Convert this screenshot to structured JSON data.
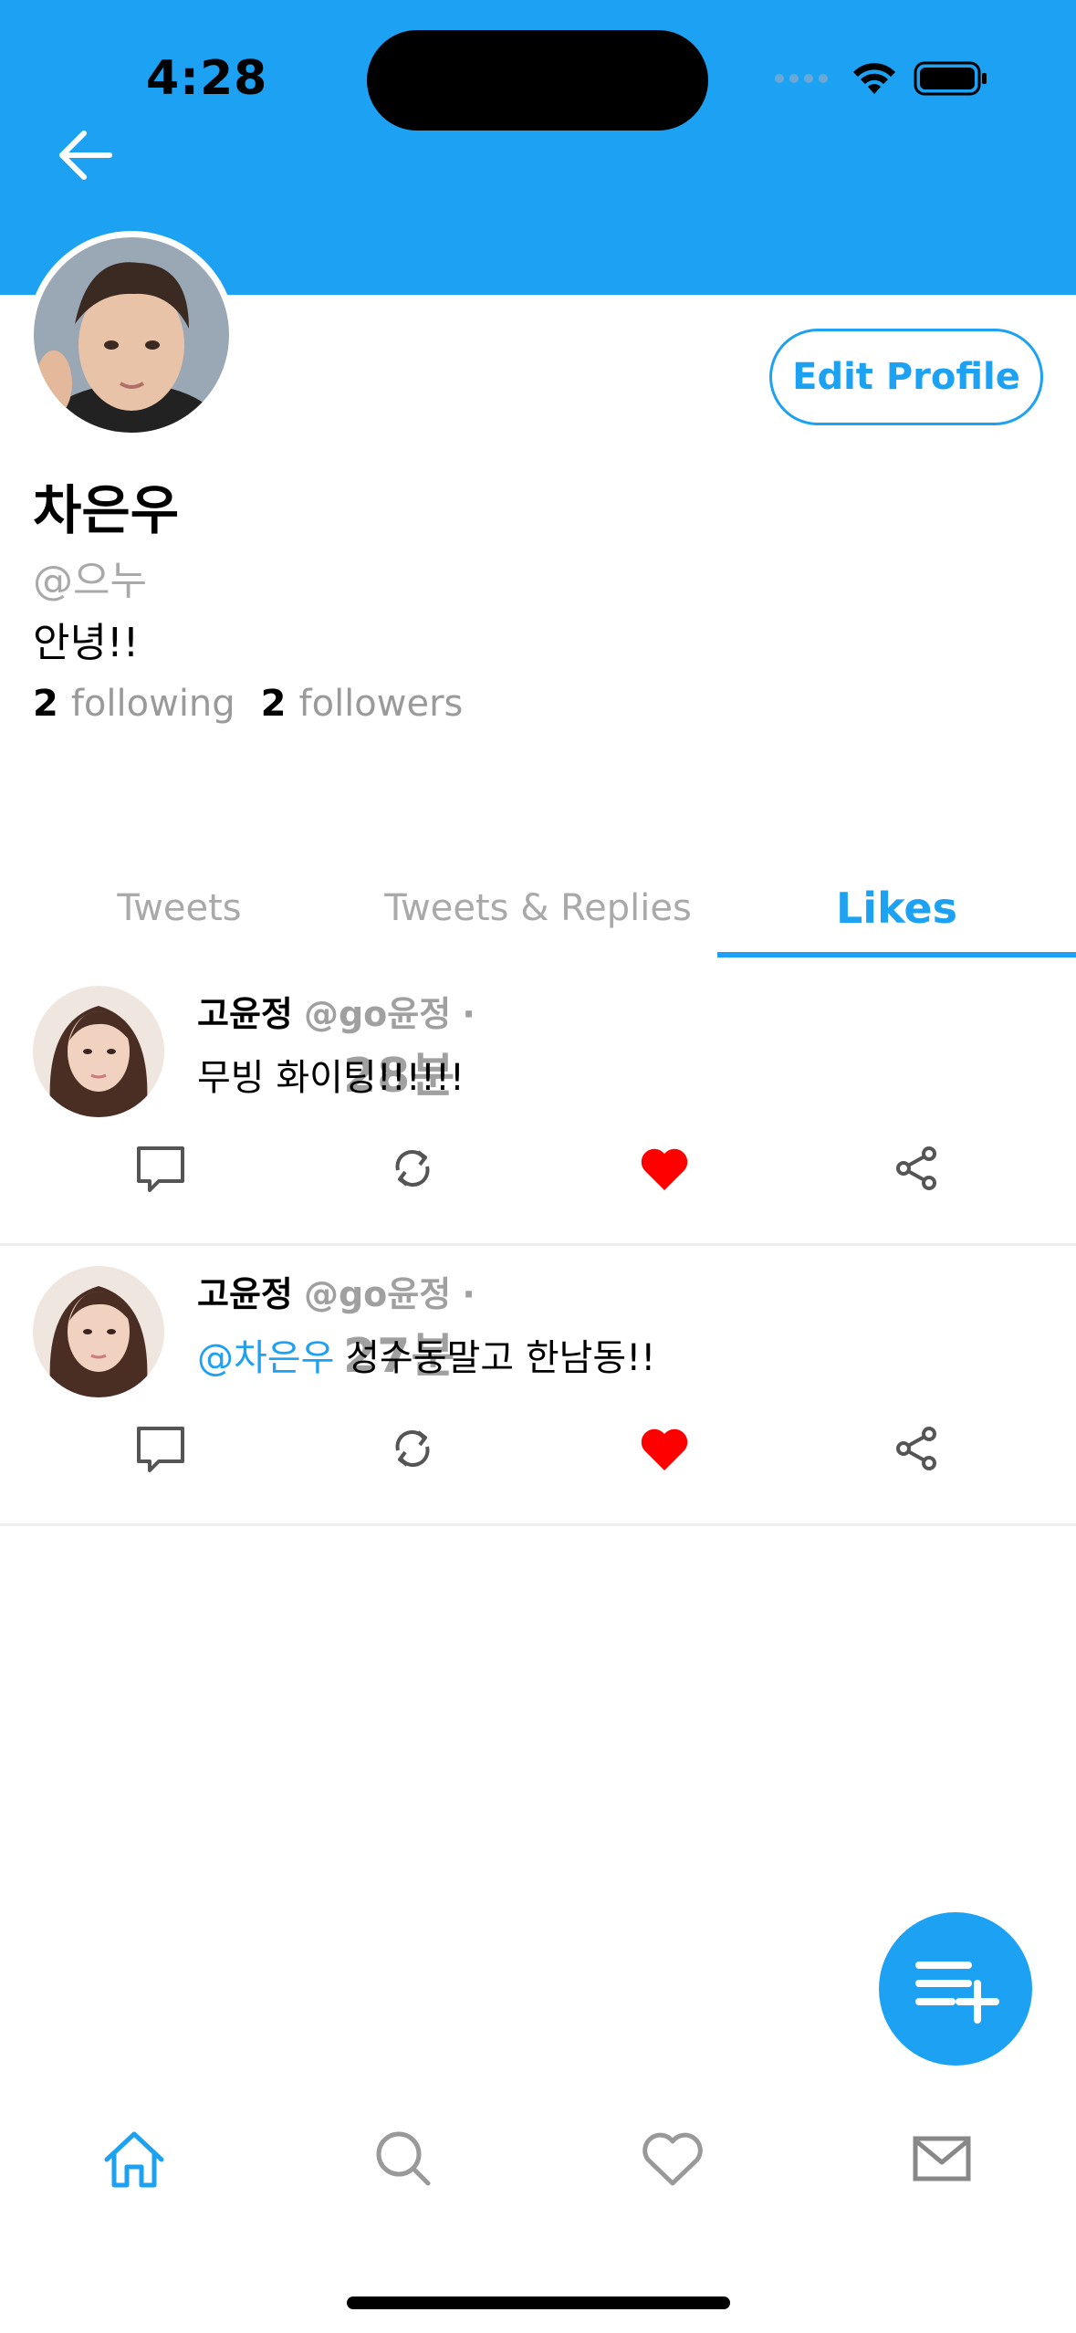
{
  "status_bar": {
    "time": "4:28"
  },
  "profile": {
    "name": "차은우",
    "handle": "@으누",
    "bio": "안녕!!",
    "following_count": "2",
    "following_label": "following",
    "followers_count": "2",
    "followers_label": "followers",
    "edit_button": "Edit Profile"
  },
  "tabs": [
    {
      "label": "Tweets",
      "active": false
    },
    {
      "label": "Tweets & Replies",
      "active": false
    },
    {
      "label": "Likes",
      "active": true
    }
  ],
  "tweets": [
    {
      "name": "고윤정",
      "handle": "@go윤정",
      "separator": "·",
      "time": "28분",
      "mention": "",
      "text": "무빙 화이팅!!!!!!",
      "liked": true
    },
    {
      "name": "고윤정",
      "handle": "@go윤정",
      "separator": "·",
      "time": "27분",
      "mention": "@차은우",
      "text": " 성수동말고 한남동!!",
      "liked": true
    }
  ],
  "colors": {
    "brand": "#1da1f2",
    "like": "#ff0000",
    "muted": "#a9a9a9"
  },
  "icons": {
    "back": "arrow-left-icon",
    "reply": "comment-icon",
    "retweet": "retweet-icon",
    "like": "heart-filled-icon",
    "share": "share-icon",
    "compose": "compose-tweet-icon",
    "nav_home": "home-icon",
    "nav_search": "search-icon",
    "nav_likes": "heart-icon",
    "nav_messages": "mail-icon"
  }
}
